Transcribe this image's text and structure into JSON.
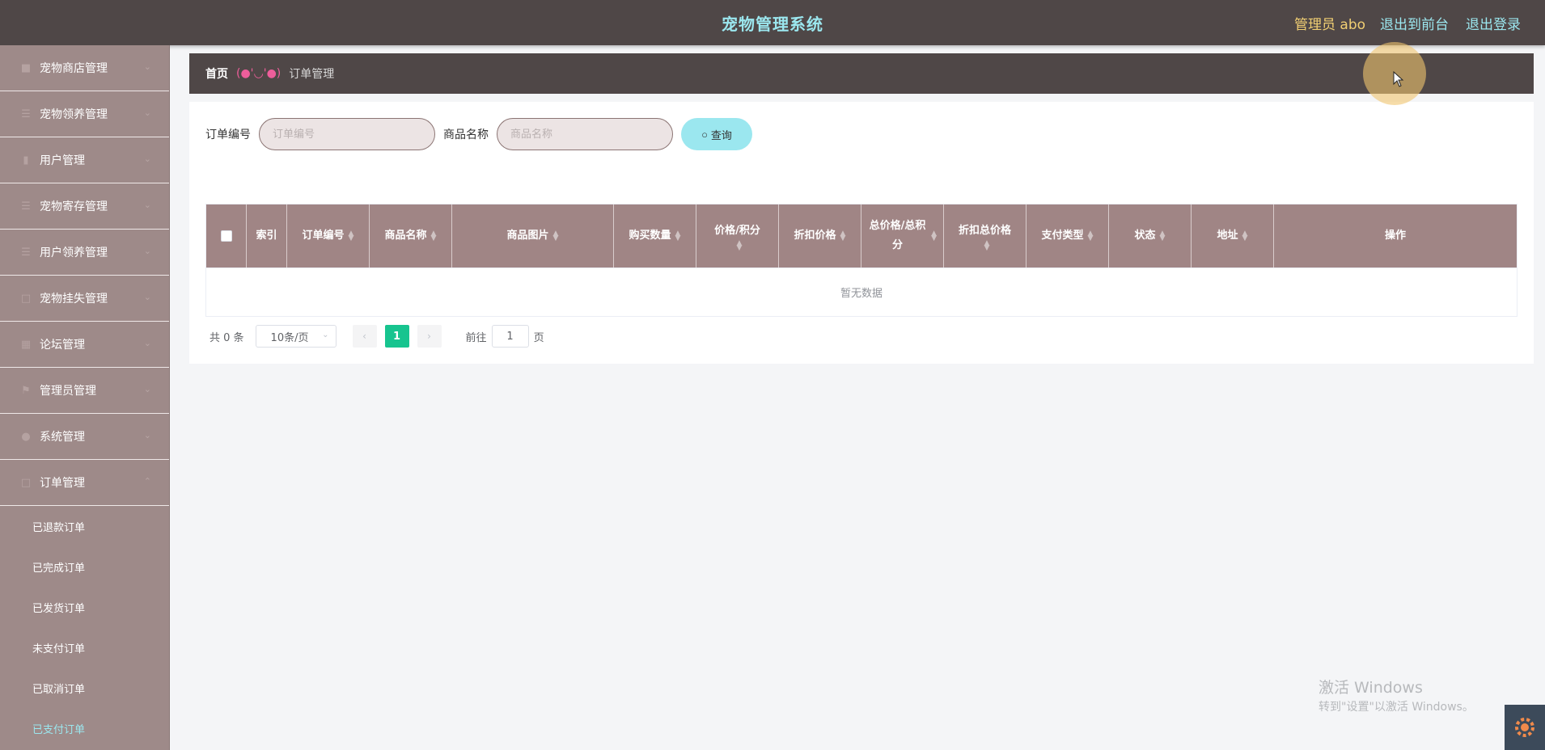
{
  "header": {
    "title": "宠物管理系统",
    "admin_label": "管理员 abo",
    "exit_to_front": "退出到前台",
    "logout": "退出登录"
  },
  "sidebar": {
    "items": [
      {
        "label": "宠物商店管理",
        "icon": "shop-icon"
      },
      {
        "label": "宠物领养管理",
        "icon": "list-icon"
      },
      {
        "label": "用户管理",
        "icon": "bar-chart-icon"
      },
      {
        "label": "宠物寄存管理",
        "icon": "list-icon"
      },
      {
        "label": "用户领养管理",
        "icon": "list-icon"
      },
      {
        "label": "宠物挂失管理",
        "icon": "document-icon"
      },
      {
        "label": "论坛管理",
        "icon": "grid-icon"
      },
      {
        "label": "管理员管理",
        "icon": "flag-icon"
      },
      {
        "label": "系统管理",
        "icon": "user-icon"
      },
      {
        "label": "订单管理",
        "icon": "document-icon"
      }
    ],
    "sub_items": [
      {
        "label": "已退款订单"
      },
      {
        "label": "已完成订单"
      },
      {
        "label": "已发货订单"
      },
      {
        "label": "未支付订单"
      },
      {
        "label": "已取消订单"
      },
      {
        "label": "已支付订单",
        "active": true
      }
    ]
  },
  "breadcrumb": {
    "home": "首页",
    "separator": "(●'◡'●)",
    "current": "订单管理"
  },
  "search": {
    "order_no_label": "订单编号",
    "order_no_placeholder": "订单编号",
    "product_name_label": "商品名称",
    "product_name_placeholder": "商品名称",
    "query_button": "查询"
  },
  "table": {
    "columns": [
      "索引",
      "订单编号",
      "商品名称",
      "商品图片",
      "购买数量",
      "价格/积分",
      "折扣价格",
      "总价格/总积分",
      "折扣总价格",
      "支付类型",
      "状态",
      "地址",
      "操作"
    ],
    "empty_text": "暂无数据"
  },
  "pagination": {
    "total_text": "共 0 条",
    "page_size": "10条/页",
    "current_page": "1",
    "goto_prefix": "前往",
    "goto_value": "1",
    "goto_suffix": "页"
  },
  "watermark": {
    "line1": "激活 Windows",
    "line2": "转到\"设置\"以激活 Windows。"
  },
  "colors": {
    "header_bg": "#4f4747",
    "sidebar_bg": "#9e8a89",
    "accent": "#9be7ef",
    "table_header_bg": "#a08585",
    "pager_active": "#17c48f"
  }
}
